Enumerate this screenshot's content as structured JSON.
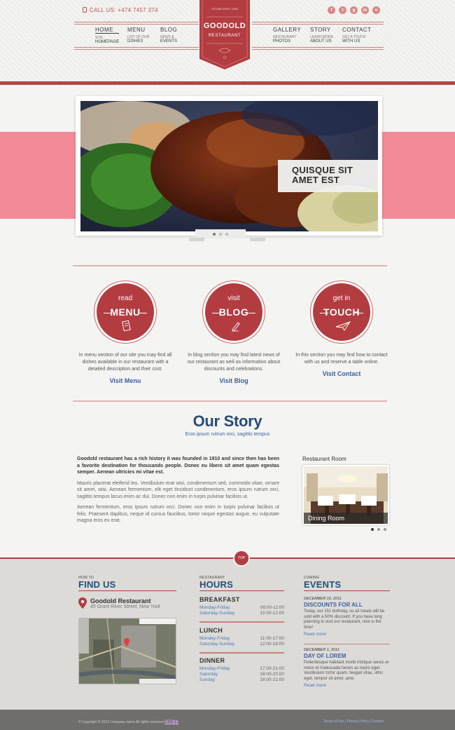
{
  "header": {
    "call_label": "CALL US: +474 7457 374",
    "socials": [
      "f",
      "t",
      "g",
      "in",
      "v"
    ],
    "logo": {
      "est": "ESTABLISHED 1958",
      "name": "GOODOLD",
      "sub": "RESTAURANT"
    },
    "nav_left": [
      {
        "title": "HOME",
        "sub": "HOMEPAGE",
        "sub_pre": "SITE"
      },
      {
        "title": "MENU",
        "sub": "LIST OF OUR",
        "sub2": "DISHES"
      },
      {
        "title": "BLOG",
        "sub": "NEWS &",
        "sub2": "EVENTS"
      }
    ],
    "nav_right": [
      {
        "title": "GALLERY",
        "sub": "RESTAURANT",
        "sub2": "PHOTOS"
      },
      {
        "title": "STORY",
        "sub": "LEARN MORE",
        "sub2": "ABOUT US"
      },
      {
        "title": "CONTACT",
        "sub": "GET A TOUCH",
        "sub2": "WITH US"
      }
    ]
  },
  "slider": {
    "caption": "QUISQUE SIT AMET EST",
    "caption_l1": "QUISQUE SIT",
    "caption_l2": "AMET EST"
  },
  "features": [
    {
      "top": "read",
      "big": "MENU",
      "text": "In menu section of our site you may find all dishes available in our restaurant with a detailed description and their cost.",
      "link": "Visit Menu"
    },
    {
      "top": "visit",
      "big": "BLOG",
      "text": "In blog section you may find latest news of our restaurant as well as information about discounts and celebrations.",
      "link": "Visit Blog"
    },
    {
      "top": "get in",
      "big": "TOUCH",
      "text": "In this section you may find how to contact with us and reserve a table online.",
      "link": "Visit Contact"
    }
  ],
  "story": {
    "title": "Our Story",
    "subtitle": "Eros ipsum rutrum orci, sagittis tempus",
    "lead": "Goodold restaurant has a rich history it was founded in 1910 and since then has been a favorite destination for thousands people. Donec eu libero sit amet quam egestas semper. Aenean ultricies mi vitae est.",
    "p1": "Mauris placerat eleifend leo. Vestibulum erat wisi, condimentum sed, commodo vitae, ornare sit amet, wisi. Aenean fermentum, elit eget tincidunt condimentum, eros ipsum rutrum orci, sagittis tempus lacus enim ac dui. Donec non enim in turpis pulvinar facilisis ut.",
    "p2": "Aenean fermentum, eros ipsum rutrum orci. Donec non enim in turpis pulvinar facilisis ut felis. Praesent dapibus, neque id cursus faucibus, tortor neque egestas augue, eu vulputate magna eros eu erat.",
    "room_label": "Restaurant Room",
    "room_caption": "Dining Room"
  },
  "top_button": "TOP",
  "find": {
    "kicker": "HOW TO",
    "title": "FIND US",
    "name": "Goodold Restaurant",
    "address": "45 Grant River Street, New York"
  },
  "hours": {
    "kicker": "RESTAURANT",
    "title": "HOURS",
    "meals": [
      {
        "name": "BREAKFAST",
        "rows": [
          {
            "d": "Monday-Friday",
            "t": "08:00-11:00"
          },
          {
            "d": "Saturday-Sunday",
            "t": "10:00-12:00"
          }
        ]
      },
      {
        "name": "LUNCH",
        "rows": [
          {
            "d": "Monday-Friday",
            "t": "11:00-17:00"
          },
          {
            "d": "Saturday-Sunday",
            "t": "12:00-18:00"
          }
        ]
      },
      {
        "name": "DINNER",
        "rows": [
          {
            "d": "Monday-Friday",
            "t": "17:00-21:00"
          },
          {
            "d": "Saturday",
            "t": "18:00-23:00"
          },
          {
            "d": "Sunday",
            "t": "18:00-21:00"
          }
        ]
      }
    ]
  },
  "events": {
    "kicker": "COMING",
    "title": "EVENTS",
    "items": [
      {
        "date": "DECEMBER 10, 2011",
        "title": "DISCOUNTS FOR ALL",
        "desc": "Today, our 151 birthday, so all meals will be sold with a 50% discount. If you have long planning to visit our restaurant, now is the time!",
        "more": "Read more"
      },
      {
        "date": "DECEMBER 1, 2011",
        "title": "DAY OF LOREM",
        "desc": "Pellentesque habitant morbi tristique senec et netus et malesuada fames ac turpis eget. Vestibulum tortor quam, feugiat vitae, ultric eget, tempor sit amet, ante.",
        "more": "Read more"
      }
    ]
  },
  "footer": {
    "copyright": "© Copyright © 2013 Company name All rights reserved",
    "copyright_link": "网页模板",
    "legal": "Terms of Use | Privacy Policy | Contact"
  },
  "colors": {
    "brand_red": "#b23c3f",
    "pink": "#f28b97",
    "heading_blue": "#2a4a7a",
    "link_blue": "#3a5f9e"
  }
}
